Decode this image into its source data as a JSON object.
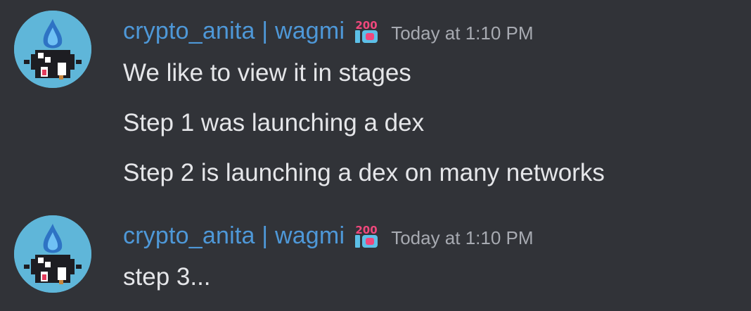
{
  "messages": [
    {
      "author": "crypto_anita | wagmi",
      "badge_icon": "100-emoji-icon",
      "timestamp": "Today at 1:10 PM",
      "avatar_icon": "pixel-cat-flame-avatar",
      "lines": [
        "We like to view it in stages",
        "Step 1 was launching a dex",
        "Step 2 is launching a dex on many networks"
      ]
    },
    {
      "author": "crypto_anita | wagmi",
      "badge_icon": "100-emoji-icon",
      "timestamp": "Today at 1:10 PM",
      "avatar_icon": "pixel-cat-flame-avatar",
      "lines": [
        "step 3..."
      ]
    }
  ],
  "colors": {
    "background": "#313338",
    "username": "#4e98d8",
    "timestamp": "#a7aab1",
    "message_text": "#e5e6e9",
    "badge_accent": "#f0487c"
  }
}
